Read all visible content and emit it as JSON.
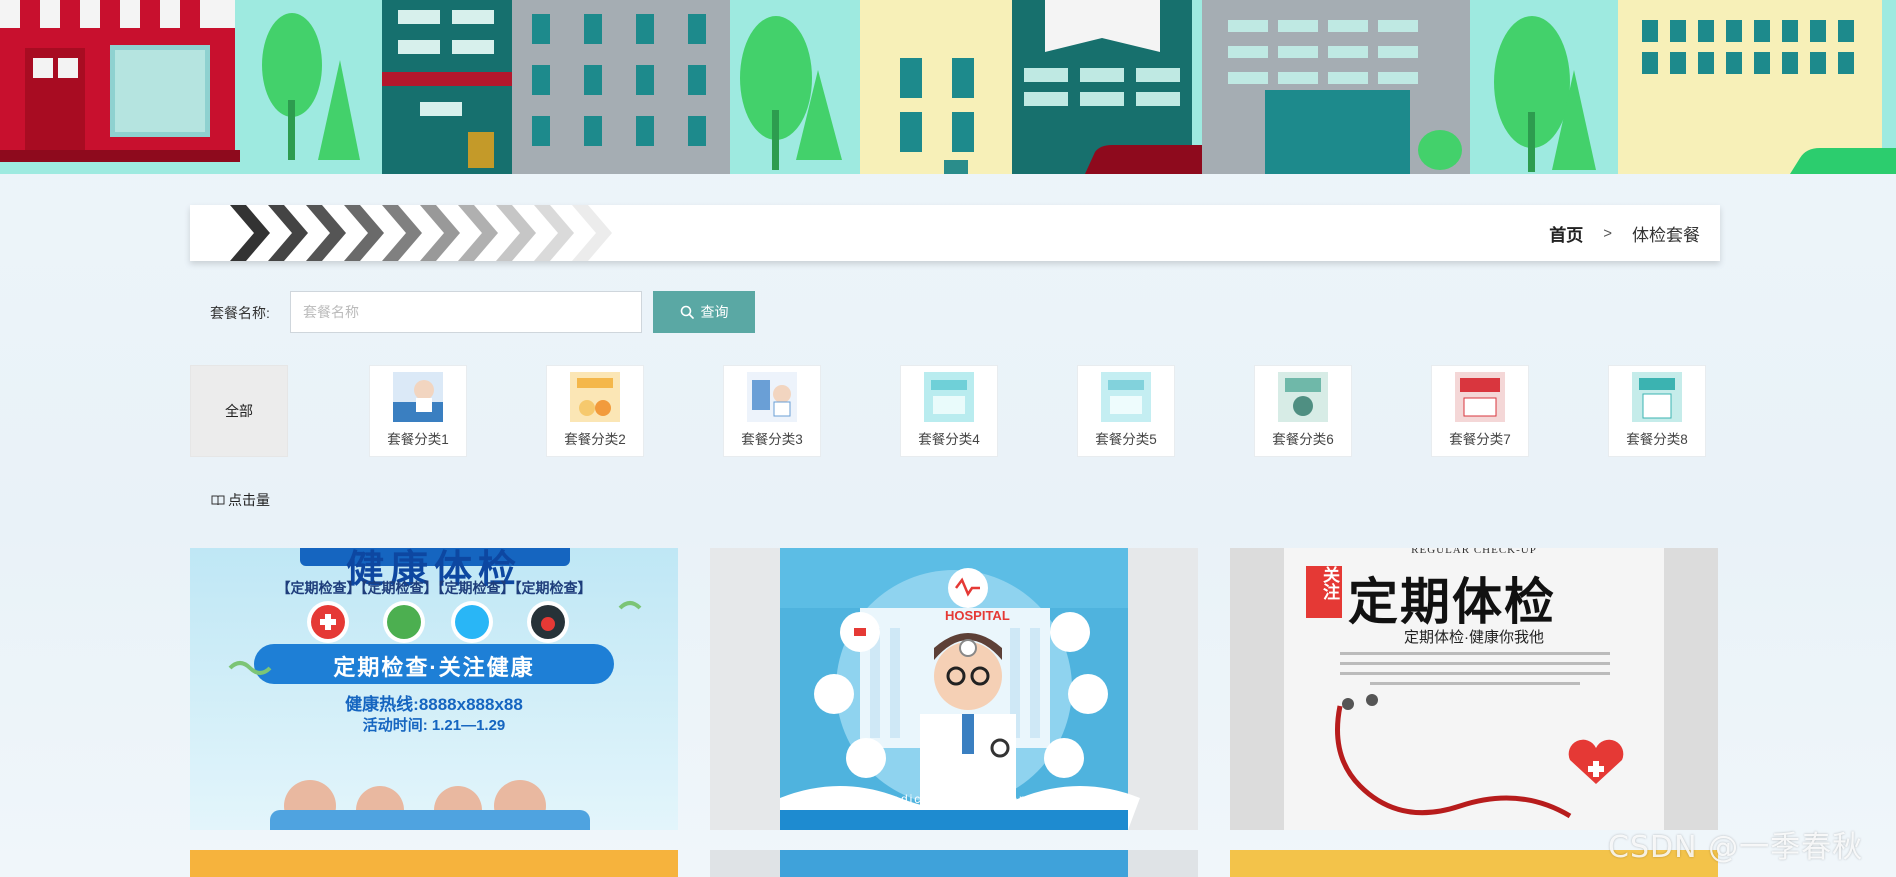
{
  "breadcrumb": {
    "home": "首页",
    "separator": ">",
    "current": "体检套餐"
  },
  "search": {
    "label": "套餐名称:",
    "placeholder": "套餐名称",
    "button_label": "查询"
  },
  "categories": {
    "all_label": "全部",
    "items": [
      {
        "label": "套餐分类1",
        "color": "#3a7fc1"
      },
      {
        "label": "套餐分类2",
        "color": "#f4b74a"
      },
      {
        "label": "套餐分类3",
        "color": "#6a9fd6"
      },
      {
        "label": "套餐分类4",
        "color": "#6fd0d8"
      },
      {
        "label": "套餐分类5",
        "color": "#82d2dc"
      },
      {
        "label": "套餐分类6",
        "color": "#6fb8a9"
      },
      {
        "label": "套餐分类7",
        "color": "#d9363e"
      },
      {
        "label": "套餐分类8",
        "color": "#3bb3b1"
      }
    ]
  },
  "sort": {
    "label": "点击量",
    "icon": "book-icon"
  },
  "cards": [
    {
      "headline": "健康体检",
      "tags": "【定期检查】【定期检查】【定期检查】【定期检查】",
      "banner": "定期检查·关注健康",
      "hotline": "健康热线:8888x888x88",
      "time": "活动时间: 1.21—1.29",
      "bg": "#bfe7f5"
    },
    {
      "hospital": "HOSPITAL",
      "subtitle": "Medical examination",
      "bg": "#4fb3de"
    },
    {
      "top_en": "REGULAR CHECK-UP",
      "badge": "关注",
      "headline": "定期体检",
      "tagline": "定期体检·健康你我他",
      "bg": "#f5f5f5"
    }
  ],
  "watermark": "CSDN @一季春秋",
  "colors": {
    "accent": "#5aa8a4",
    "banner_sky": "#9eeae0"
  }
}
